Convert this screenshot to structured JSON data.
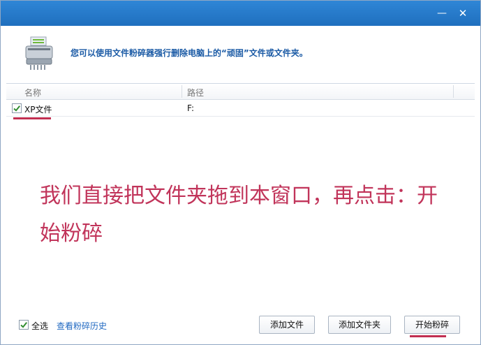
{
  "window": {
    "minimize_icon": "minimize-icon",
    "close_icon": "close-icon"
  },
  "header": {
    "icon": "shredder-icon",
    "text": "您可以使用文件粉碎器强行删除电脑上的“顽固”文件或文件夹。"
  },
  "list": {
    "columns": [
      "名称",
      "路径"
    ],
    "rows": [
      {
        "checked": true,
        "name": "XP文件",
        "path": "F:"
      }
    ]
  },
  "annotation": {
    "instruction": "我们直接把文件夹拖到本窗口，再点击：开始粉碎"
  },
  "footer": {
    "select_all_checked": true,
    "select_all_label": "全选",
    "history_link": "查看粉碎历史",
    "add_file_button": "添加文件",
    "add_folder_button": "添加文件夹",
    "start_shred_button": "开始粉碎"
  },
  "colors": {
    "titlebar": "#2a7fd0",
    "header_text": "#1a5aa5",
    "annotation": "#c1345a",
    "link": "#1f68c1"
  }
}
